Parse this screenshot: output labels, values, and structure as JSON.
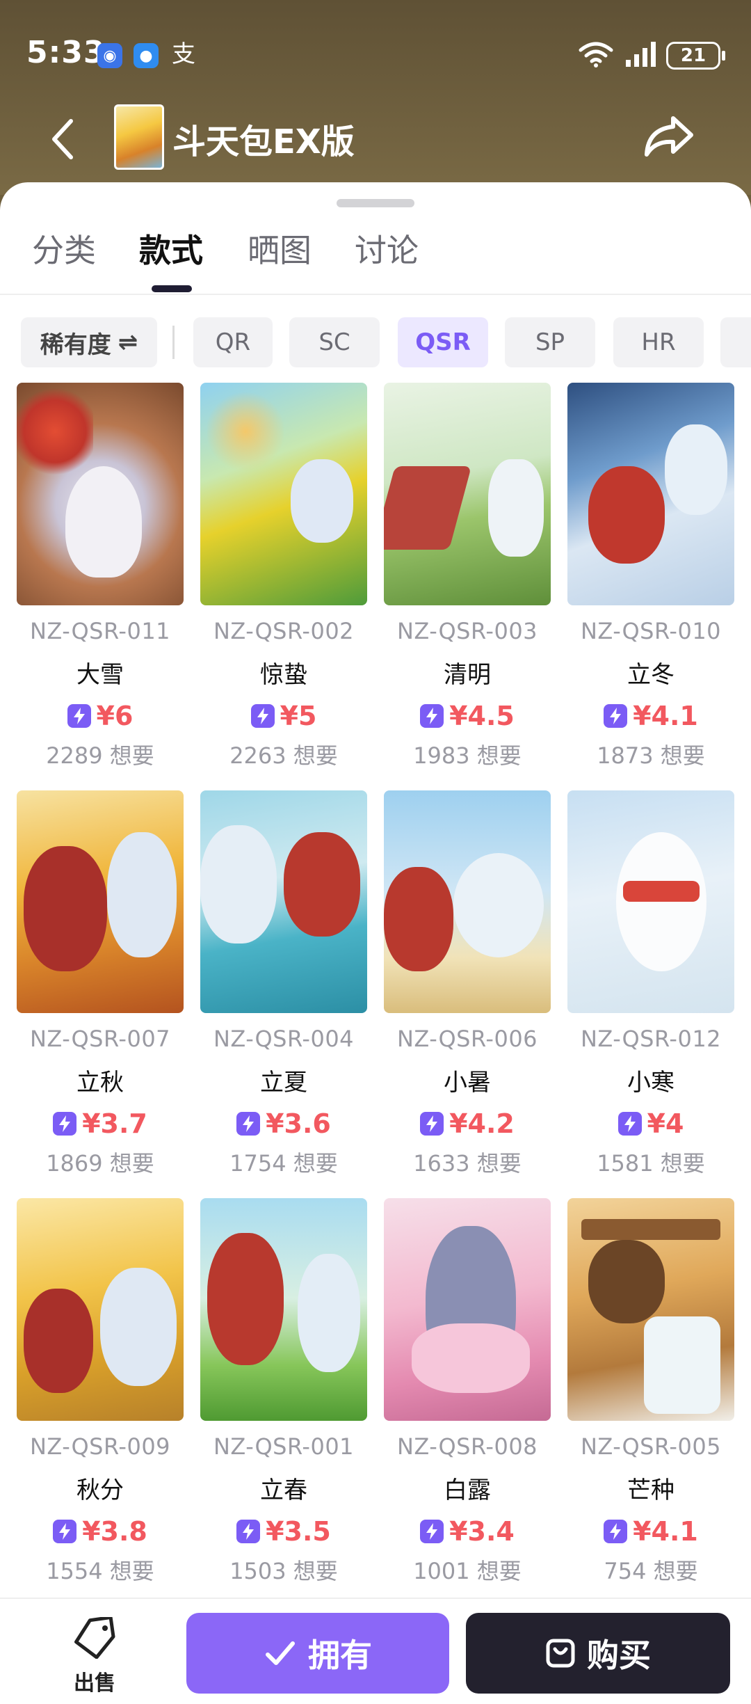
{
  "status_bar": {
    "time": "5:33",
    "battery": "21",
    "app_icon_c": "支"
  },
  "header": {
    "title": "斗天包EX版",
    "back_icon": "chevron-left-icon",
    "share_icon": "share-icon"
  },
  "tabs": [
    "分类",
    "款式",
    "晒图",
    "讨论"
  ],
  "filters": {
    "rarity_label": "稀有度",
    "rarity_icon": "⇌",
    "chips": [
      "QR",
      "SC",
      "QSR",
      "SP",
      "HR"
    ],
    "active": "QSR"
  },
  "cards": [
    {
      "code": "NZ-QSR-011",
      "name": "大雪",
      "price": "¥6",
      "want": "2289 想要"
    },
    {
      "code": "NZ-QSR-002",
      "name": "惊蛰",
      "price": "¥5",
      "want": "2263 想要"
    },
    {
      "code": "NZ-QSR-003",
      "name": "清明",
      "price": "¥4.5",
      "want": "1983 想要"
    },
    {
      "code": "NZ-QSR-010",
      "name": "立冬",
      "price": "¥4.1",
      "want": "1873 想要"
    },
    {
      "code": "NZ-QSR-007",
      "name": "立秋",
      "price": "¥3.7",
      "want": "1869 想要"
    },
    {
      "code": "NZ-QSR-004",
      "name": "立夏",
      "price": "¥3.6",
      "want": "1754 想要"
    },
    {
      "code": "NZ-QSR-006",
      "name": "小暑",
      "price": "¥4.2",
      "want": "1633 想要"
    },
    {
      "code": "NZ-QSR-012",
      "name": "小寒",
      "price": "¥4",
      "want": "1581 想要"
    },
    {
      "code": "NZ-QSR-009",
      "name": "秋分",
      "price": "¥3.8",
      "want": "1554 想要"
    },
    {
      "code": "NZ-QSR-001",
      "name": "立春",
      "price": "¥3.5",
      "want": "1503 想要"
    },
    {
      "code": "NZ-QSR-008",
      "name": "白露",
      "price": "¥3.4",
      "want": "1001 想要"
    },
    {
      "code": "NZ-QSR-005",
      "name": "芒种",
      "price": "¥4.1",
      "want": "754 想要"
    }
  ],
  "bottom": {
    "sell_label": "出售",
    "own_label": "拥有",
    "buy_label": "购买"
  },
  "colors": {
    "accent": "#8b67f7",
    "price": "#f2585f",
    "buy_bg": "#23212e",
    "header_bg": "#6e5e3c"
  }
}
